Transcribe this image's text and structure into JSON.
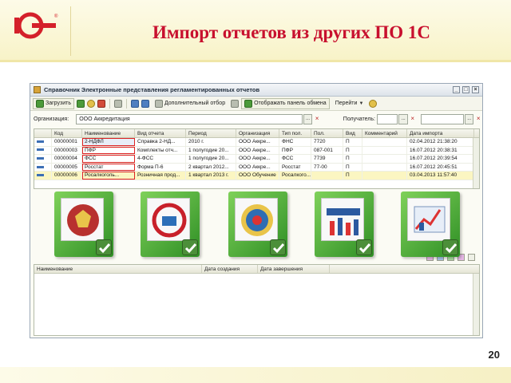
{
  "slide": {
    "title": "Импорт отчетов из других ПО 1С",
    "page_number": "20",
    "logo_text": "1С",
    "accent_color": "#c8102e"
  },
  "window": {
    "title": "Справочник Электронные представления регламентированных отчетов",
    "toolbar": {
      "load": "Загрузить",
      "extra_filter": "Дополнительный отбор",
      "show_panel": "Отображать панель обмена",
      "goto": "Перейти"
    },
    "filter": {
      "org_label": "Организация:",
      "org_value": "ООО Аккредитация",
      "recipient_label": "Получатель:"
    },
    "columns": [
      "Код",
      "Наименование",
      "Вид отчета",
      "Период",
      "Организация",
      "Тип пол.",
      "Пол.",
      "Вид",
      "Комментарий",
      "Дата импорта"
    ],
    "rows": [
      [
        "00000001",
        "2-НДФЛ",
        "Справка 2-НД...",
        "2010 г.",
        "ООО Аккре...",
        "ФНС",
        "7720",
        "П",
        "",
        "02.04.2012 21:38:20"
      ],
      [
        "00000003",
        "ПФР",
        "Комплекты отч...",
        "1 полугодие 20...",
        "ООО Аккре...",
        "ПФР",
        "087-001",
        "П",
        "",
        "16.07.2012 20:38:31"
      ],
      [
        "00000004",
        "ФСС",
        "4-ФСС",
        "1 полугодие 20...",
        "ООО Аккре...",
        "ФСС",
        "7739",
        "П",
        "",
        "16.07.2012 20:39:54"
      ],
      [
        "00000005",
        "Росстат",
        "Форма П-6",
        "2 квартал 2012...",
        "ООО Аккре...",
        "Росстат",
        "77-00",
        "П",
        "",
        "16.07.2012 20:45:51"
      ],
      [
        "00000006",
        "Росалкоголь...",
        "Розничная прод...",
        "1 квартал 2013 г.",
        "ООО Обучение",
        "Росалкого...",
        "",
        "П",
        "",
        "03.04.2013 11:57:40"
      ]
    ],
    "bottom_columns": [
      "Наименование",
      "Дата создания",
      "Дата завершения"
    ],
    "report_icons": [
      "fns-emblem-icon",
      "pfr-emblem-icon",
      "fss-emblem-icon",
      "rosstat-icon",
      "rosalkogol-chart-icon"
    ]
  }
}
